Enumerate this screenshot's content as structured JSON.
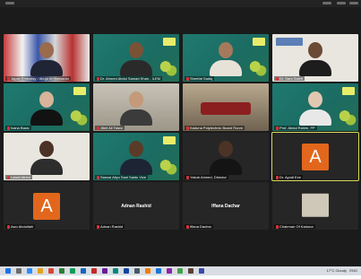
{
  "meeting": {
    "tiles": [
      {
        "id": "t1",
        "style": "flags",
        "name": "Japan Embassy / Abuja Ambassador",
        "muted": true
      },
      {
        "id": "t2",
        "style": "teal",
        "name": "Dr. Ahmed Abdul Samad Khan - ILEM",
        "muted": true
      },
      {
        "id": "t3",
        "style": "teal",
        "name": "Sheefat Sadiq",
        "muted": true
      },
      {
        "id": "t4",
        "style": "light",
        "name": "Dr. Sara Saleh",
        "muted": true
      },
      {
        "id": "t5",
        "style": "teal",
        "name": "Ivana Basic",
        "muted": true
      },
      {
        "id": "t6",
        "style": "office",
        "name": "Jibril Ali Taiwo",
        "muted": true
      },
      {
        "id": "t7",
        "style": "room",
        "name": "Kaduna Polytechnic Board Room",
        "muted": true
      },
      {
        "id": "t8",
        "style": "teal",
        "name": "Prof. Abdul Rahim, FP",
        "muted": true
      },
      {
        "id": "t9",
        "style": "light",
        "name": "Lawal Abdul",
        "muted": true
      },
      {
        "id": "t10",
        "style": "teal",
        "name": "Sanusi Aliyu Sani Saidu Vice",
        "muted": true
      },
      {
        "id": "t11",
        "style": "dark",
        "name": "Yakub Ahmed, Director",
        "muted": true
      },
      {
        "id": "t12",
        "style": "dark",
        "name": "Dr. Ayodi Eze",
        "muted": true,
        "avatar": "A",
        "active": true
      },
      {
        "id": "t13",
        "style": "dark",
        "name": "Awo Abdullahi",
        "muted": true,
        "avatar": "A"
      },
      {
        "id": "t14",
        "style": "dark",
        "name": "Adnan Rashid",
        "muted": true,
        "center_label": "Adnan Rashid"
      },
      {
        "id": "t15",
        "style": "dark",
        "name": "Iffana Dachar",
        "muted": true,
        "center_label": "Iffana Dachar"
      },
      {
        "id": "t16",
        "style": "dark",
        "name": "Chairman Of Kaduna",
        "muted": true,
        "thumbnail": true
      }
    ]
  },
  "taskbar": {
    "weather": "17°C Cloudy",
    "tray": "ENG"
  },
  "colors": {
    "accent_orange": "#e2671c",
    "active_border": "#d9d95a",
    "teal_bg": "#1f7a6f"
  }
}
